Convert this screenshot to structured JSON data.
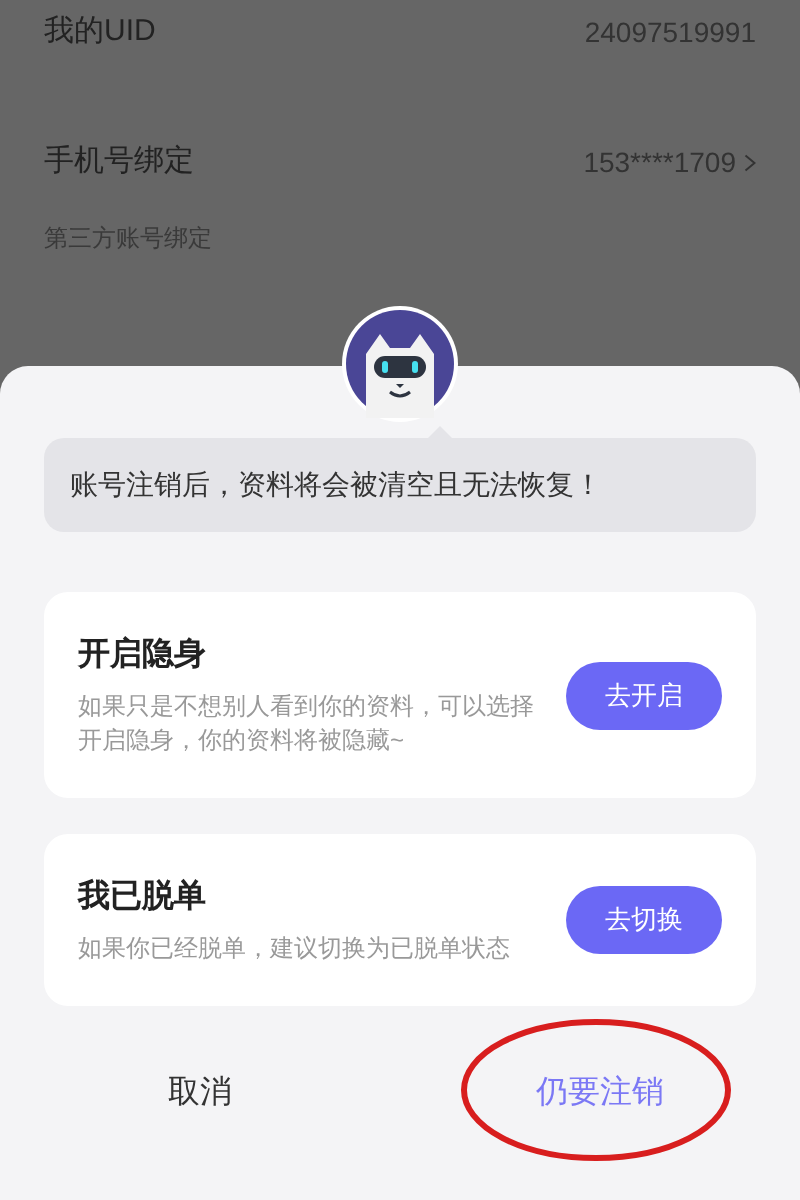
{
  "background": {
    "rows": [
      {
        "label": "我的UID",
        "value": "24097519991",
        "chevron": false
      },
      {
        "label": "手机号绑定",
        "value": "153****1709",
        "chevron": true
      }
    ],
    "section_label": "第三方账号绑定"
  },
  "dialog": {
    "warning": "账号注销后，资料将会被清空且无法恢复！",
    "options": [
      {
        "title": "开启隐身",
        "description": "如果只是不想别人看到你的资料，可以选择开启隐身，你的资料将被隐藏~",
        "button": "去开启"
      },
      {
        "title": "我已脱单",
        "description": "如果你已经脱单，建议切换为已脱单状态",
        "button": "去切换"
      }
    ],
    "buttons": [
      {
        "label": "取消",
        "kind": "cancel",
        "circled": false
      },
      {
        "label": "仍要注销",
        "kind": "confirm",
        "circled": true
      }
    ]
  }
}
